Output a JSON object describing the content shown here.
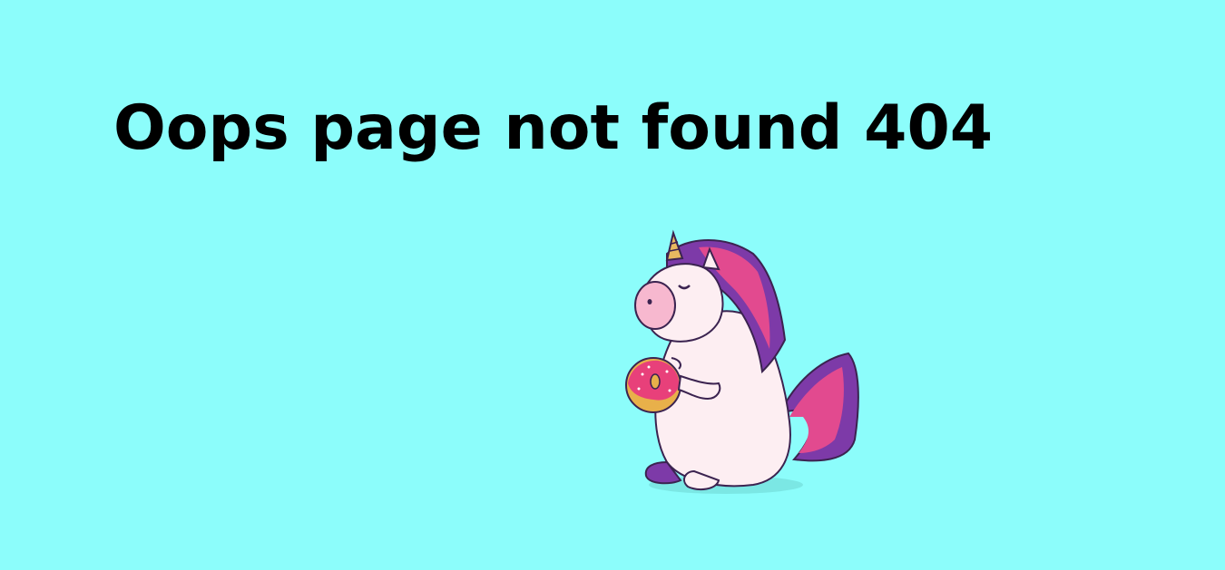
{
  "page": {
    "title": "Oops page not found 404",
    "background_color": "#8cfdfb"
  },
  "illustration": {
    "subject": "unicorn-holding-donut-icon",
    "colors": {
      "body": "#fdeef2",
      "outline": "#3b2350",
      "mane_pink": "#e24a8f",
      "mane_purple": "#7d3aa8",
      "horn": "#e8b960",
      "donut_frosting": "#e8407a",
      "donut_dough": "#e8b04a"
    }
  }
}
